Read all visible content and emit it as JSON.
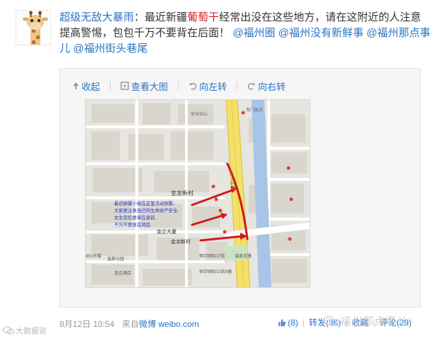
{
  "post": {
    "author": "超级无敌大暴雨",
    "colon": "：",
    "text_1": "最近新疆",
    "highlight": "葡萄干",
    "text_2": "经常出没在这些地方，请在这附近的人注意提高警惕，包包千万不要背在后面！",
    "mentions": [
      "@福州圈",
      "@福州",
      "没有新鲜事",
      "@福州那点事儿",
      "@福州街头巷尾"
    ]
  },
  "toolbar": {
    "collapse_label": "收起",
    "view_large_label": "查看大图",
    "rotate_left_label": "向左转",
    "rotate_right_label": "向右转"
  },
  "map": {
    "labels": {
      "jinlong": "金龙新村",
      "jinqi": "金企大厦",
      "jinlong2": "金龙新村",
      "hengyu": "恒宇国际公馆",
      "hengyu2": "恒宇国际公馆A幢",
      "yuda": "宇大中心",
      "road": "六一北路",
      "dongjia": "东门东方",
      "wendong": "温泉支路",
      "lu_851": "851大楼",
      "wenquan": "温泉公园",
      "jinqi_hotel": "金企酒店"
    },
    "note": [
      "最近新疆小偷在这里活动频繁,",
      "大家要注意自己的生命财产安全,",
      "女生包包要拿在身前,",
      "千万不要放在背后"
    ]
  },
  "footer": {
    "time": "8月12日 10:54",
    "source_prefix": "来自",
    "source_link": "微博 weibo.com",
    "like_count": "(8)",
    "repost_label": "转发(36)",
    "favorite_label": "收藏",
    "comment_label": "评论(29)"
  },
  "watermark": {
    "left": "大数据说",
    "right": "福州那点事儿"
  },
  "colors": {
    "link": "#2b74c1",
    "highlight": "#d5261f",
    "arrow": "#d11919",
    "note_text": "#2233cc"
  }
}
